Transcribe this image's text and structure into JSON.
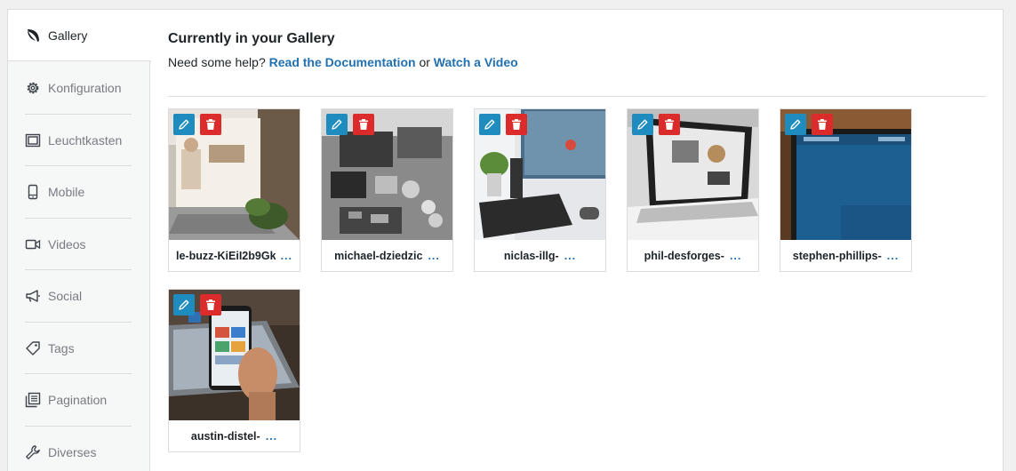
{
  "sidebar": {
    "items": [
      {
        "label": "Gallery",
        "icon": "leaf-icon",
        "active": true
      },
      {
        "label": "Konfiguration",
        "icon": "gear-icon"
      },
      {
        "label": "Leuchtkasten",
        "icon": "lightbox-icon"
      },
      {
        "label": "Mobile",
        "icon": "mobile-icon"
      },
      {
        "label": "Videos",
        "icon": "video-icon"
      },
      {
        "label": "Social",
        "icon": "megaphone-icon"
      },
      {
        "label": "Tags",
        "icon": "tag-icon"
      },
      {
        "label": "Pagination",
        "icon": "pagination-icon"
      },
      {
        "label": "Diverses",
        "icon": "wrench-icon"
      }
    ]
  },
  "main": {
    "title": "Currently in your Gallery",
    "help_prefix": "Need some help?",
    "doc_link": "Read the Documentation",
    "help_or": "or",
    "video_link": "Watch a Video"
  },
  "gallery": {
    "more_label": "...",
    "images": [
      {
        "name": "le-buzz-KiEiI2b9Gk"
      },
      {
        "name": "michael-dziedzic"
      },
      {
        "name": "niclas-illg-"
      },
      {
        "name": "phil-desforges-"
      },
      {
        "name": "stephen-phillips-"
      },
      {
        "name": "austin-distel-"
      }
    ]
  },
  "colors": {
    "link": "#2271b1",
    "edit_button": "#1e8cbe",
    "delete_button": "#dc2b2b"
  }
}
